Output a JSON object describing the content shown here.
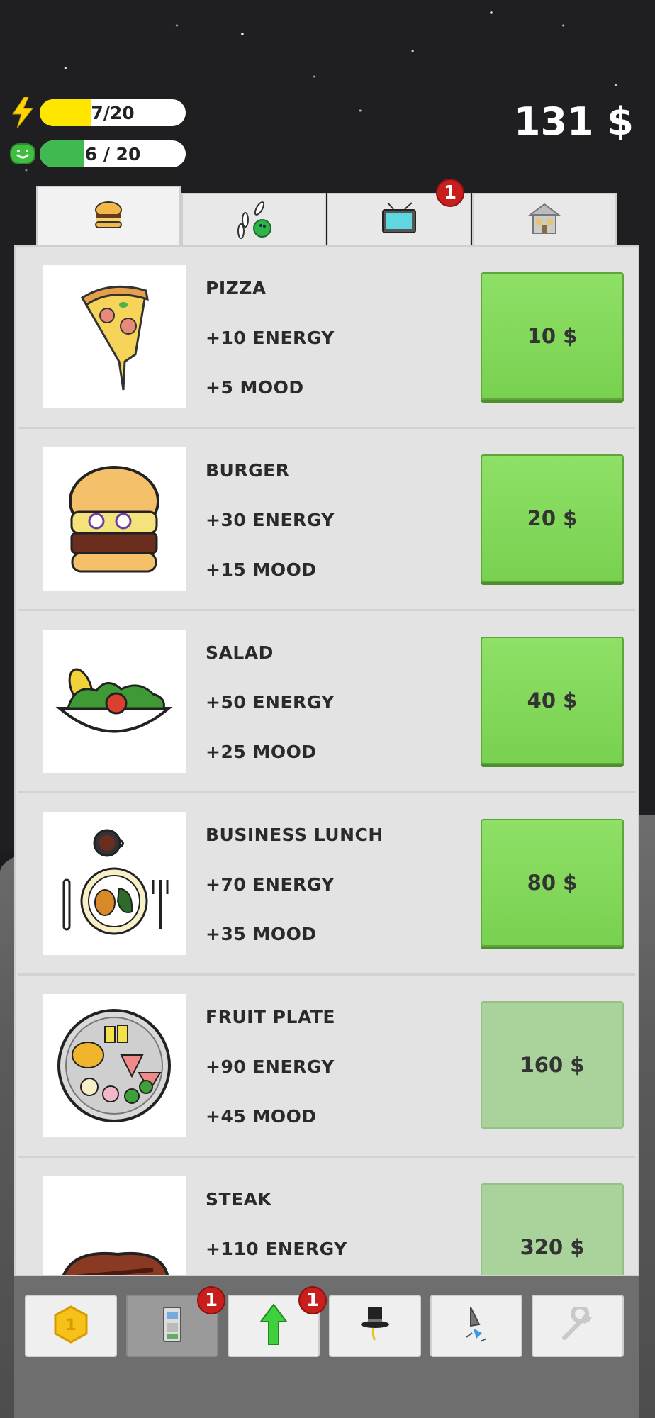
{
  "hud": {
    "energy": {
      "current": 7,
      "max": 20,
      "text_current": "7",
      "text_sep": " / ",
      "text_max": "20",
      "color": "#ffe600"
    },
    "mood": {
      "current": 6,
      "max": 20,
      "text": "6 / 20",
      "color": "#3fb950"
    },
    "money": "131 $"
  },
  "tabs": [
    {
      "id": "food",
      "icon": "burger-icon",
      "active": true
    },
    {
      "id": "fun",
      "icon": "bowling-icon",
      "active": false
    },
    {
      "id": "tv",
      "icon": "tv-icon",
      "active": false,
      "badge": "1"
    },
    {
      "id": "home",
      "icon": "house-icon",
      "active": false
    }
  ],
  "items": [
    {
      "name": "PIZZA",
      "energy": "+10 ENERGY",
      "mood": "+5 MOOD",
      "price": "10 $",
      "affordable": true,
      "icon": "pizza-icon"
    },
    {
      "name": "BURGER",
      "energy": "+30 ENERGY",
      "mood": "+15 MOOD",
      "price": "20 $",
      "affordable": true,
      "icon": "burger-icon"
    },
    {
      "name": "SALAD",
      "energy": "+50 ENERGY",
      "mood": "+25 MOOD",
      "price": "40 $",
      "affordable": true,
      "icon": "salad-icon"
    },
    {
      "name": "BUSINESS LUNCH",
      "energy": "+70 ENERGY",
      "mood": "+35 MOOD",
      "price": "80 $",
      "affordable": true,
      "icon": "business-lunch-icon"
    },
    {
      "name": "FRUIT PLATE",
      "energy": "+90 ENERGY",
      "mood": "+45 MOOD",
      "price": "160 $",
      "affordable": false,
      "icon": "fruit-plate-icon"
    },
    {
      "name": "STEAK",
      "energy": "+110 ENERGY",
      "mood": "",
      "price": "320 $",
      "affordable": false,
      "icon": "steak-icon"
    }
  ],
  "toolbar": [
    {
      "icon": "coin-icon",
      "active": false
    },
    {
      "icon": "atm-icon",
      "active": true,
      "badge": "1"
    },
    {
      "icon": "upgrade-arrow-icon",
      "active": false,
      "badge": "1"
    },
    {
      "icon": "top-hat-icon",
      "active": false
    },
    {
      "icon": "rocket-icon",
      "active": false
    },
    {
      "icon": "wrench-icon",
      "active": false
    }
  ]
}
